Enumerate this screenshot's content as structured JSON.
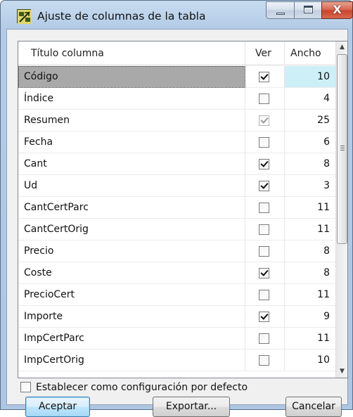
{
  "window": {
    "title": "Ajuste de columnas de la tabla",
    "close_glyph": "X"
  },
  "grid": {
    "headers": {
      "title": "Título columna",
      "ver": "Ver",
      "ancho": "Ancho"
    },
    "rows": [
      {
        "name": "Código",
        "visible": true,
        "disabled": false,
        "width": "10",
        "selected": true
      },
      {
        "name": "Índice",
        "visible": false,
        "disabled": false,
        "width": "4",
        "selected": false
      },
      {
        "name": "Resumen",
        "visible": true,
        "disabled": true,
        "width": "25",
        "selected": false
      },
      {
        "name": "Fecha",
        "visible": false,
        "disabled": false,
        "width": "6",
        "selected": false
      },
      {
        "name": "Cant",
        "visible": true,
        "disabled": false,
        "width": "8",
        "selected": false
      },
      {
        "name": "Ud",
        "visible": true,
        "disabled": false,
        "width": "3",
        "selected": false
      },
      {
        "name": "CantCertParc",
        "visible": false,
        "disabled": false,
        "width": "11",
        "selected": false
      },
      {
        "name": "CantCertOrig",
        "visible": false,
        "disabled": false,
        "width": "11",
        "selected": false
      },
      {
        "name": "Precio",
        "visible": false,
        "disabled": false,
        "width": "8",
        "selected": false
      },
      {
        "name": "Coste",
        "visible": true,
        "disabled": false,
        "width": "8",
        "selected": false
      },
      {
        "name": "PrecioCert",
        "visible": false,
        "disabled": false,
        "width": "11",
        "selected": false
      },
      {
        "name": "Importe",
        "visible": true,
        "disabled": false,
        "width": "9",
        "selected": false
      },
      {
        "name": "ImpCertParc",
        "visible": false,
        "disabled": false,
        "width": "11",
        "selected": false
      },
      {
        "name": "ImpCertOrig",
        "visible": false,
        "disabled": false,
        "width": "10",
        "selected": false
      }
    ]
  },
  "default_config": {
    "label": "Establecer como configuración por defecto",
    "checked": false
  },
  "buttons": {
    "accept": "Aceptar",
    "export": "Exportar...",
    "cancel": "Cancelar"
  },
  "colors": {
    "selected_row": "#a9a9a9",
    "selected_width_cell": "#cceff8",
    "accept_border": "#3c7fb1"
  },
  "icons": {
    "app": "table-columns-icon",
    "minimize": "minimize-icon",
    "maximize": "maximize-icon",
    "close": "close-icon"
  }
}
